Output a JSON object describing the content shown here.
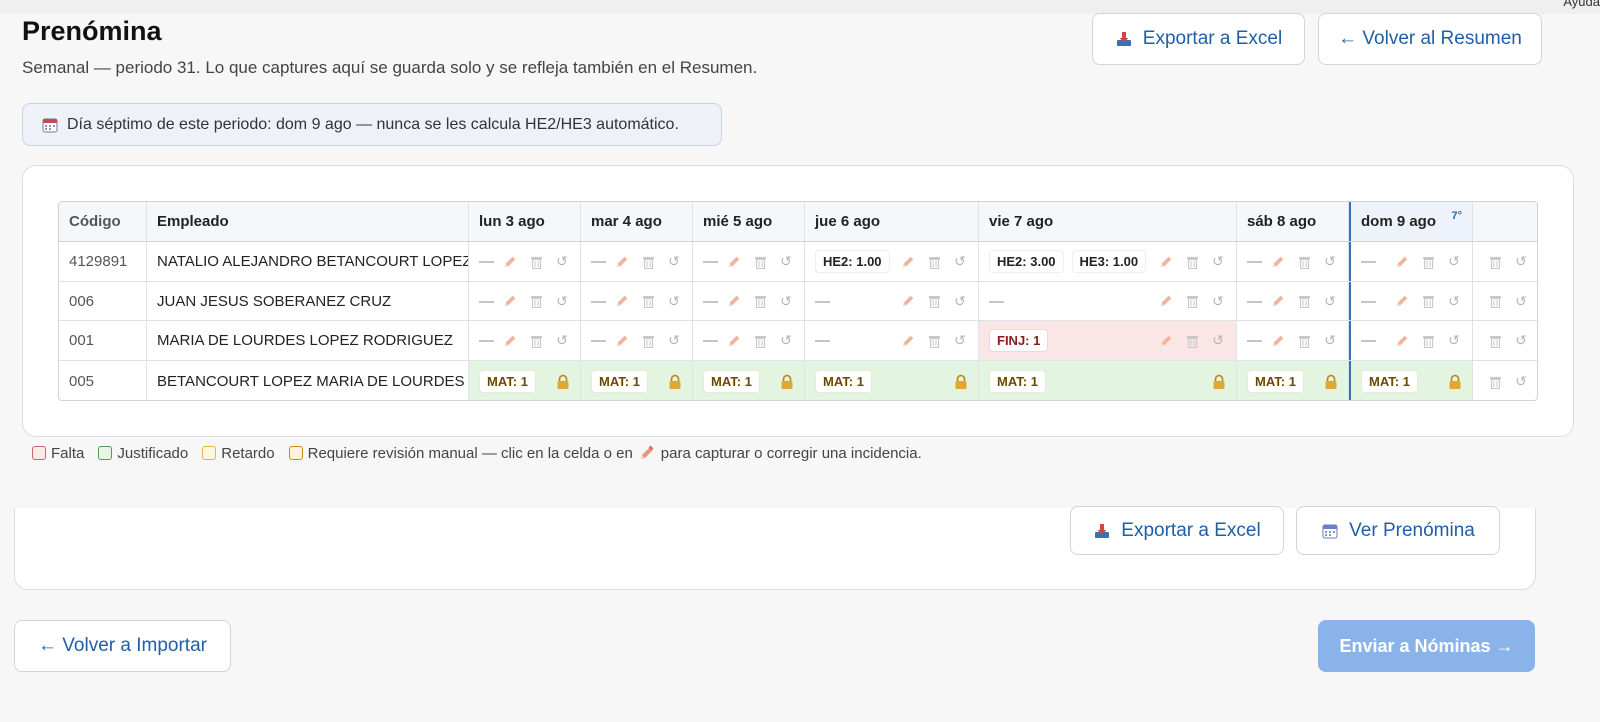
{
  "header": {
    "help_cut": "Ayuda",
    "title": "Prenómina",
    "subtitle": "Semanal — periodo 31. Lo que captures aquí se guarda solo y se refleja también en el Resumen.",
    "export_label": "Exportar a Excel",
    "back_summary_label": "← Volver al Resumen"
  },
  "info_note": "Día séptimo de este periodo: dom 9 ago — nunca se les calcula HE2/HE3 automático.",
  "table": {
    "columns": [
      "Código",
      "Empleado",
      "lun 3 ago",
      "mar 4 ago",
      "mié 5 ago",
      "jue 6 ago",
      "vie 7 ago",
      "sáb 8 ago",
      "dom 9 ago"
    ],
    "seventh_marker": "7°",
    "empty_mark": "—",
    "rows": [
      {
        "code": "4129891",
        "name": "NATALIO ALEJANDRO BETANCOURT LOPEZ",
        "jue": "HE2: 1.00",
        "vie_a": "HE2: 3.00",
        "vie_b": "HE3: 1.00"
      },
      {
        "code": "006",
        "name": "JUAN JESUS SOBERANEZ CRUZ"
      },
      {
        "code": "001",
        "name": "MARIA DE LOURDES LOPEZ RODRIGUEZ",
        "vie": "FINJ: 1"
      },
      {
        "code": "005",
        "name": "BETANCOURT LOPEZ MARIA DE LOURDES",
        "mat": "MAT: 1"
      }
    ]
  },
  "legend": {
    "falta": "Falta",
    "justificado": "Justificado",
    "retardo": "Retardo",
    "manual_a": "Requiere revisión manual — clic en la celda o en",
    "manual_b": "para capturar o corregir una incidencia."
  },
  "lower": {
    "export_label": "Exportar a Excel",
    "view_label": "Ver Prenómina"
  },
  "footer": {
    "back_import_label": "← Volver a Importar",
    "send_label": "Enviar a Nóminas →"
  },
  "colors": {
    "accent": "#1f5fa8",
    "falta": "#fbe6e6",
    "justificado": "#e3f4e1",
    "send_disabled": "#8ab3ea"
  }
}
